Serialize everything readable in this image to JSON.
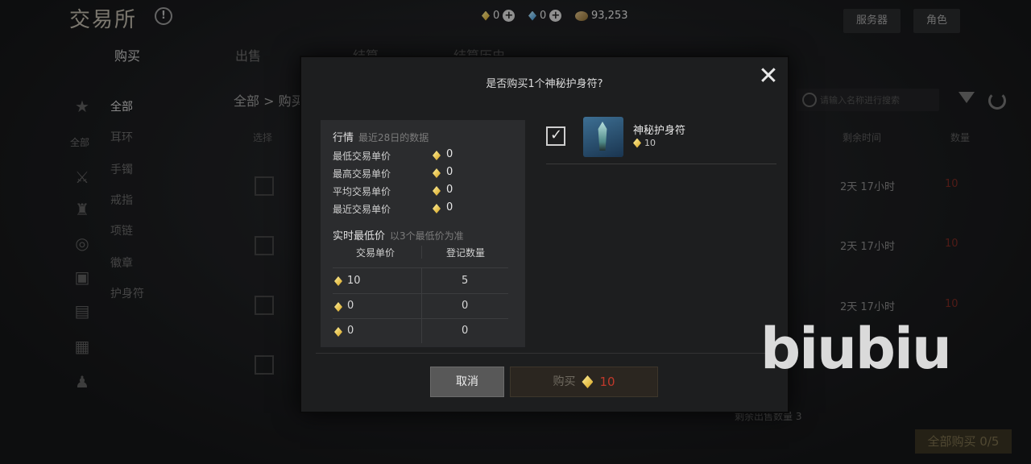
{
  "header": {
    "logo": "交易所",
    "currencies": [
      {
        "icon": "gold-gem-icon",
        "value": "0"
      },
      {
        "icon": "blue-gem-icon",
        "value": "0"
      },
      {
        "icon": "silver-coin-icon",
        "value": "93,253"
      }
    ],
    "server_button": "服务器",
    "lock_button": "角色"
  },
  "tabs": [
    "购买",
    "出售",
    "结算",
    "结算历史"
  ],
  "breadcrumb": {
    "root": "全部",
    "current": "购买"
  },
  "sidebar": {
    "items": [
      "全部",
      "耳环",
      "手镯",
      "戒指",
      "项链",
      "徽章",
      "护身符"
    ],
    "category_label": "全部"
  },
  "list": {
    "header_select": "选择",
    "header_time": "剩余时间",
    "header_count": "数量",
    "search_placeholder": "请输入名称进行搜索",
    "rows": [
      {
        "time": "2天 17小时",
        "count": "10"
      },
      {
        "time": "2天 17小时",
        "count": "10"
      },
      {
        "time": "2天 17小时",
        "count": "10"
      }
    ],
    "bottom_note": "剩余出售数量 3",
    "buy_all": "全部购买 0/5"
  },
  "modal": {
    "title": "是否购买1个神秘护身符?",
    "market": {
      "title": "行情",
      "subtitle": "最近28日的数据",
      "stats": [
        {
          "label": "最低交易单价",
          "value": "0"
        },
        {
          "label": "最高交易单价",
          "value": "0"
        },
        {
          "label": "平均交易单价",
          "value": "0"
        },
        {
          "label": "最近交易单价",
          "value": "0"
        }
      ]
    },
    "realtime": {
      "title": "实时最低价",
      "subtitle": "以3个最低价为准",
      "col_price": "交易单价",
      "col_qty": "登记数量",
      "rows": [
        {
          "price": "10",
          "qty": "5"
        },
        {
          "price": "0",
          "qty": "0"
        },
        {
          "price": "0",
          "qty": "0"
        }
      ]
    },
    "item": {
      "name": "神秘护身符",
      "price": "10",
      "checked": true
    },
    "cancel_label": "取消",
    "buy_label": "购买",
    "buy_price": "10"
  },
  "watermark": "biubiu",
  "colors": {
    "gold": "#d6a21c",
    "price_red": "#c0392b",
    "panel": "#2b2c2e"
  }
}
